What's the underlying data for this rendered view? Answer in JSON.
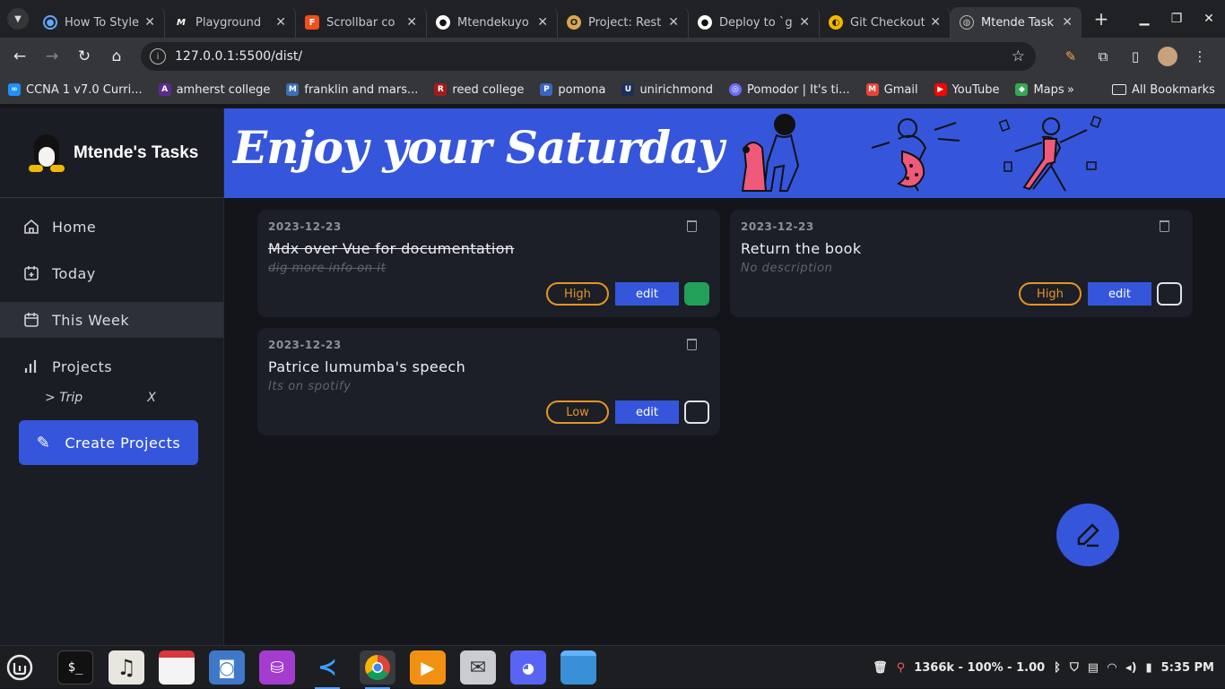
{
  "browser": {
    "tabs": [
      {
        "title": "How To Style",
        "icon": "react-icon",
        "color": "#61a8ff"
      },
      {
        "title": "Playground",
        "icon": "mdx-icon",
        "color": "#ffffff"
      },
      {
        "title": "Scrollbar co",
        "icon": "figma-icon",
        "color": "#f24e1e"
      },
      {
        "title": "Mtendekuyo",
        "icon": "github-icon",
        "color": "#ffffff"
      },
      {
        "title": "Project: Rest",
        "icon": "odin-icon",
        "color": "#d9a84e"
      },
      {
        "title": "Deploy to `g",
        "icon": "github-icon",
        "color": "#ffffff"
      },
      {
        "title": "Git Checkout",
        "icon": "git-icon",
        "color": "#f7b500"
      },
      {
        "title": "Mtende Task",
        "icon": "globe-icon",
        "color": "#9aa0a6",
        "active": true
      }
    ],
    "url": "127.0.0.1:5500/dist/",
    "bookmarks": [
      {
        "label": "CCNA 1 v7.0 Curri...",
        "color": "#1e90ff"
      },
      {
        "label": "amherst college",
        "color": "#5b2c8e"
      },
      {
        "label": "franklin and mars...",
        "color": "#3b6fb6"
      },
      {
        "label": "reed college",
        "color": "#a01c1c"
      },
      {
        "label": "pomona",
        "color": "#3d64c2"
      },
      {
        "label": "unirichmond",
        "color": "#1c2f5a"
      },
      {
        "label": "Pomodor | It's ti...",
        "color": "#6c6cff"
      },
      {
        "label": "Gmail",
        "color": "#ea4335"
      },
      {
        "label": "YouTube",
        "color": "#ff0000"
      },
      {
        "label": "Maps",
        "color": "#34a853"
      }
    ],
    "bookmarks_more": "»",
    "all_bookmarks": "All Bookmarks"
  },
  "app": {
    "brand": "Mtende's Tasks",
    "banner": "Enjoy your Saturday",
    "nav": [
      {
        "label": "Home",
        "icon": "home-icon"
      },
      {
        "label": "Today",
        "icon": "calendar-plus-icon"
      },
      {
        "label": "This Week",
        "icon": "calendar-icon",
        "active": true
      },
      {
        "label": "Projects",
        "icon": "bar-chart-icon"
      }
    ],
    "project": {
      "name": "> Trip",
      "remove": "X"
    },
    "create_label": "Create Projects",
    "cards": [
      {
        "date": "2023-12-23",
        "title": "Mdx over Vue for documentation",
        "desc": "dig more info on it",
        "priority": "High",
        "edit": "edit",
        "done": true
      },
      {
        "date": "2023-12-23",
        "title": "Return the book",
        "desc": "No description",
        "priority": "High",
        "edit": "edit",
        "done": false
      },
      {
        "date": "2023-12-23",
        "title": "Patrice lumumba's speech",
        "desc": "Its on spotify",
        "priority": "Low",
        "edit": "edit",
        "done": false
      }
    ],
    "colors": {
      "accent": "#3556db",
      "priority": "#e69424",
      "done": "#22a05a"
    }
  },
  "taskbar": {
    "apps": [
      "mint-menu-icon",
      "terminal-icon",
      "music-icon",
      "calendar-icon",
      "camera-icon",
      "database-icon",
      "vscode-icon",
      "chrome-icon",
      "media-player-icon",
      "mail-icon",
      "discord-icon",
      "files-icon"
    ],
    "status": "1366k - 100% - 1.00",
    "time": "5:35 PM"
  }
}
